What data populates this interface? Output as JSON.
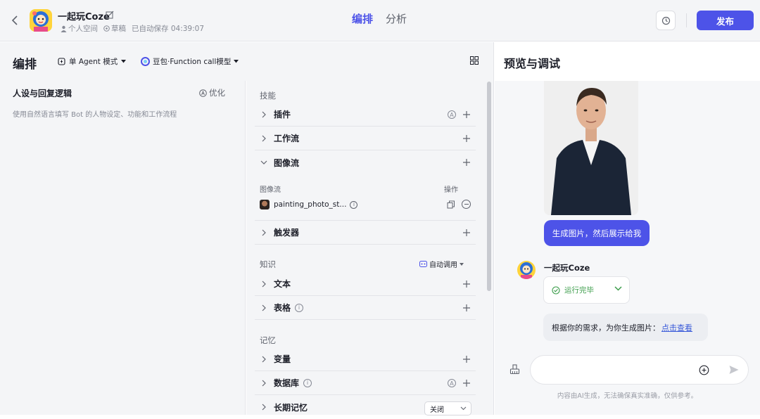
{
  "topbar": {
    "bot_name": "一起玩Coze",
    "space": "个人空间",
    "status": "草稿",
    "autosave": "已自动保存 04:39:07",
    "tabs": [
      {
        "label": "编排",
        "active": true
      },
      {
        "label": "分析",
        "active": false
      }
    ],
    "publish_label": "发布"
  },
  "editor": {
    "title": "编排",
    "mode": "单 Agent 模式",
    "model": "豆包·Function call模型"
  },
  "persona": {
    "title": "人设与回复逻辑",
    "optimize_label": "优化",
    "placeholder": "使用自然语言填写 Bot 的人物设定、功能和工作流程"
  },
  "skills": {
    "section_label": "技能",
    "items": {
      "plugin": "插件",
      "workflow": "工作流",
      "imageflow": "图像流",
      "trigger": "触发器"
    },
    "imageflow_table": {
      "col_name": "图像流",
      "col_action": "操作",
      "entry": "painting_photo_st..."
    }
  },
  "knowledge": {
    "section_label": "知识",
    "auto_call": "自动调用",
    "items": {
      "text": "文本",
      "table": "表格"
    }
  },
  "memory": {
    "section_label": "记忆",
    "items": {
      "variables": "变量",
      "database": "数据库",
      "long_term": "长期记忆"
    },
    "long_term_value": "关闭"
  },
  "preview": {
    "title": "预览与调试",
    "user_message": "生成图片，然后展示给我",
    "bot_name": "一起玩Coze",
    "run_status": "运行完毕",
    "reply_text": "根据你的需求，为你生成图片：",
    "reply_link": "点击查看",
    "input_placeholder": "",
    "disclaimer": "内容由AI生成，无法确保真实准确，仅供参考。"
  },
  "colors": {
    "accent": "#4d53e8",
    "success": "#3c9d4b",
    "link": "#3a5bd9"
  }
}
